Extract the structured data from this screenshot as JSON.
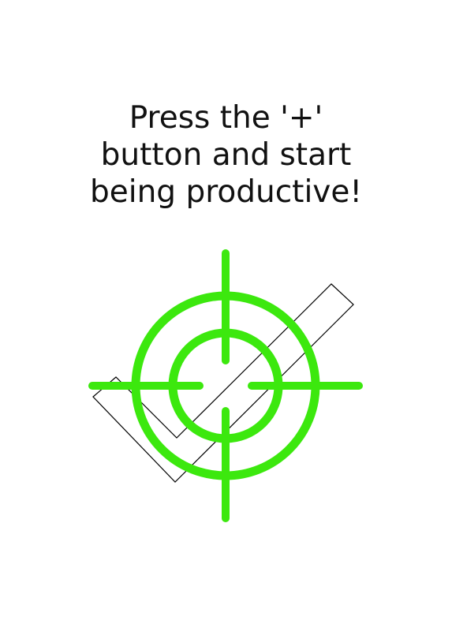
{
  "empty_state": {
    "message_lines": [
      "Press the '+'",
      "button and start",
      "being productive!"
    ]
  },
  "illustration": {
    "crosshair_icon": "crosshair-icon",
    "checkmark_icon": "checkmark-outline-icon",
    "accent_color": "#3ce80e",
    "outline_color": "#000000"
  }
}
